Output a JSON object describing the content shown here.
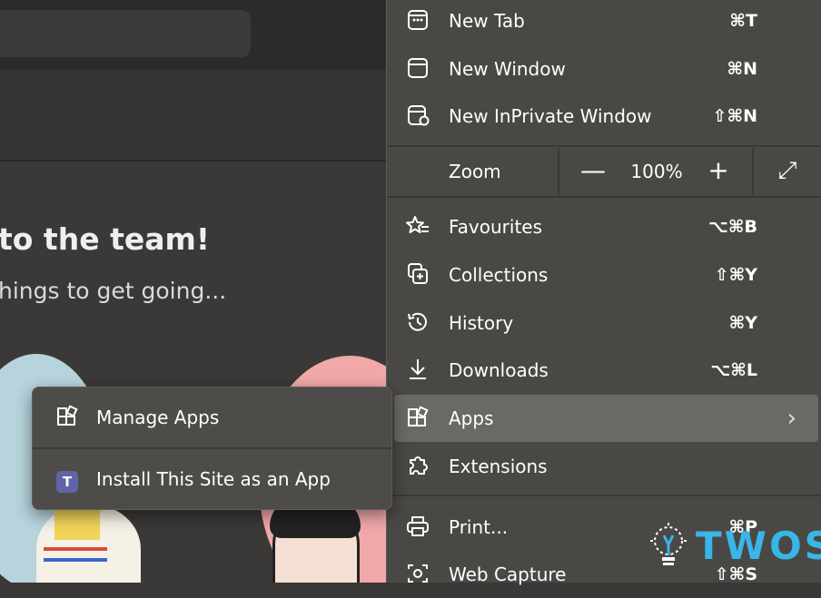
{
  "page": {
    "heading": "to the team!",
    "subheading": "hings to get going..."
  },
  "menu": {
    "items": [
      {
        "label": "New Tab",
        "shortcut": "⌘T",
        "icon": "new-tab-icon"
      },
      {
        "label": "New Window",
        "shortcut": "⌘N",
        "icon": "new-window-icon"
      },
      {
        "label": "New InPrivate Window",
        "shortcut": "⇧⌘N",
        "icon": "inprivate-icon"
      },
      {
        "label": "Favourites",
        "shortcut": "⌥⌘B",
        "icon": "favourites-icon"
      },
      {
        "label": "Collections",
        "shortcut": "⇧⌘Y",
        "icon": "collections-icon"
      },
      {
        "label": "History",
        "shortcut": "⌘Y",
        "icon": "history-icon"
      },
      {
        "label": "Downloads",
        "shortcut": "⌥⌘L",
        "icon": "download-icon"
      },
      {
        "label": "Apps",
        "shortcut": "",
        "icon": "apps-icon"
      },
      {
        "label": "Extensions",
        "shortcut": "",
        "icon": "extensions-icon"
      },
      {
        "label": "Print...",
        "shortcut": "⌘P",
        "icon": "print-icon"
      },
      {
        "label": "Web Capture",
        "shortcut": "⇧⌘S",
        "icon": "web-capture-icon"
      }
    ],
    "zoom": {
      "label": "Zoom",
      "value": "100%",
      "minus": "—",
      "plus": "+",
      "fullscreen": "⤢"
    }
  },
  "submenu": {
    "items": [
      {
        "label": "Manage Apps",
        "icon": "manage-apps-icon"
      },
      {
        "label": "Install This Site as an App",
        "icon": "teams-app-icon"
      }
    ]
  },
  "watermark": {
    "text": "TWOS"
  },
  "colors": {
    "menu_bg": "#4a4845",
    "hover_bg": "#6b6965",
    "watermark": "#38b6e8"
  }
}
